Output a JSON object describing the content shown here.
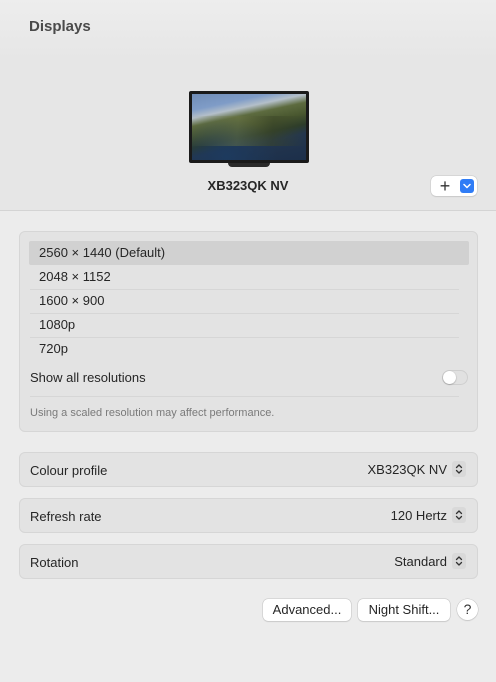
{
  "window": {
    "title": "Displays"
  },
  "display": {
    "name": "XB323QK NV",
    "add_symbol": "+"
  },
  "resolutions": {
    "items": [
      {
        "label": "2560 × 1440 (Default)",
        "selected": true
      },
      {
        "label": "2048 × 1152",
        "selected": false
      },
      {
        "label": "1600 × 900",
        "selected": false
      },
      {
        "label": "1080p",
        "selected": false
      },
      {
        "label": "720p",
        "selected": false
      }
    ],
    "show_all_label": "Show all resolutions",
    "show_all_enabled": false,
    "hint": "Using a scaled resolution may affect performance."
  },
  "settings": {
    "colour_profile": {
      "label": "Colour profile",
      "value": "XB323QK NV"
    },
    "refresh_rate": {
      "label": "Refresh rate",
      "value": "120 Hertz"
    },
    "rotation": {
      "label": "Rotation",
      "value": "Standard"
    }
  },
  "buttons": {
    "advanced": "Advanced...",
    "night_shift": "Night Shift...",
    "help": "?"
  },
  "colors": {
    "accent": "#2f7cf6",
    "selected_row": "#d1d1d1"
  },
  "icons": {
    "add": "plus-icon",
    "add_menu": "chevron-down-icon",
    "stepper": "up-down-chevron-icon"
  }
}
